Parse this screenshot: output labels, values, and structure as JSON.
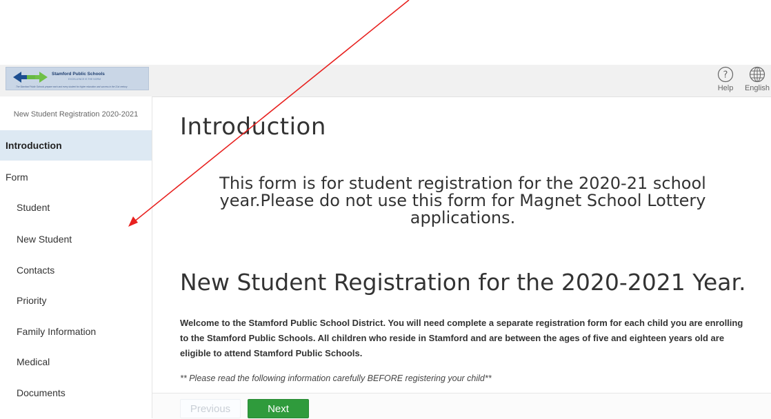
{
  "header": {
    "logo": {
      "name": "Stamford Public Schools",
      "tagline": "EXCELLENCE IS THE NORM",
      "motto": "The Stamford Public Schools prepare each and every student for higher education and success in the 21st century"
    },
    "help_label": "Help",
    "language_label": "English",
    "icons": {
      "help": "question-circle-icon",
      "language": "globe-icon"
    }
  },
  "sidebar": {
    "title": "New Student Registration 2020-2021",
    "items": [
      {
        "label": "Introduction",
        "active": true
      },
      {
        "label": "Form"
      },
      {
        "label": "Student"
      },
      {
        "label": "New Student"
      },
      {
        "label": "Contacts"
      },
      {
        "label": "Priority"
      },
      {
        "label": "Family Information"
      },
      {
        "label": "Medical"
      },
      {
        "label": "Documents"
      }
    ]
  },
  "main": {
    "heading": "Introduction",
    "notice": "This form is for student registration for the 2020-21 school year.Please do not use this form for Magnet School Lottery applications.",
    "subheading": "New Student Registration for the 2020-2021 Year.",
    "welcome": "Welcome to the Stamford Public School District. You will need complete a separate registration form for each child you are enrolling to the Stamford Public Schools. All children who reside in Stamford and are between the ages of five and eighteen years old are eligible to attend Stamford Public Schools.",
    "note": "** Please read the following information carefully BEFORE registering your child**"
  },
  "footer": {
    "previous_label": "Previous",
    "next_label": "Next"
  },
  "colors": {
    "accent_green": "#2f9b3c",
    "active_nav": "#dde9f3",
    "annotation_arrow": "#e8211f"
  }
}
